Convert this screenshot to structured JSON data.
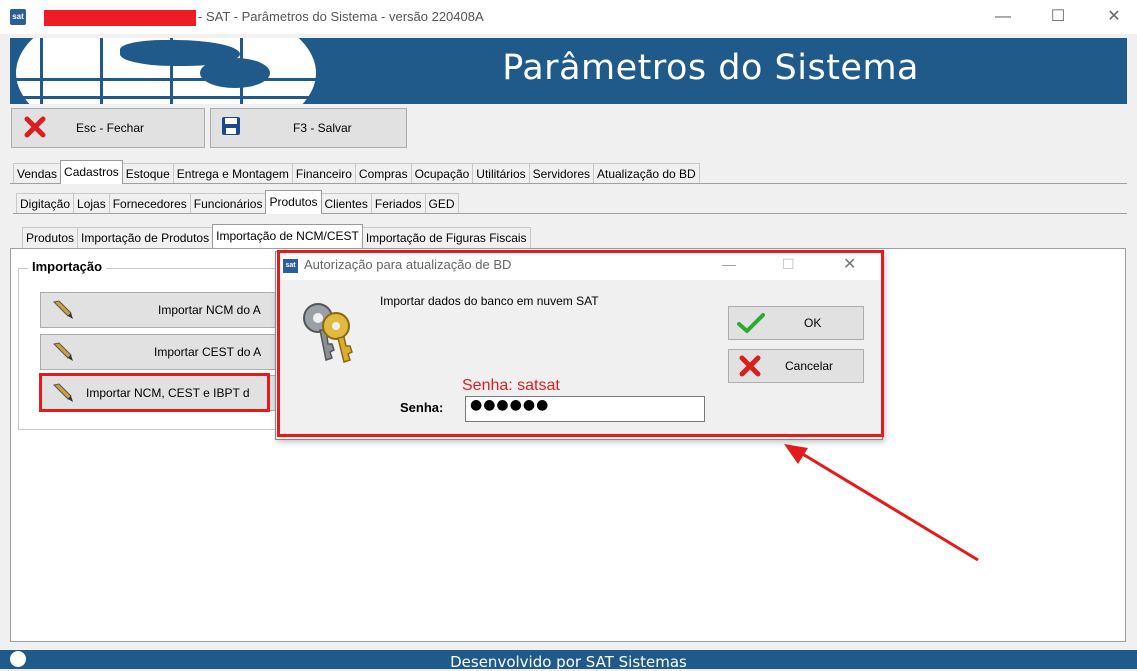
{
  "window": {
    "title": "- SAT - Parâmetros do Sistema - versão 220408A",
    "app_icon": "sat-logo-icon"
  },
  "banner": {
    "title": "Parâmetros do Sistema"
  },
  "toolbar": {
    "close_label": "Esc - Fechar",
    "save_label": "F3 - Salvar"
  },
  "tabs_main": [
    "Vendas",
    "Cadastros",
    "Estoque",
    "Entrega e Montagem",
    "Financeiro",
    "Compras",
    "Ocupação",
    "Utilitários",
    "Servidores",
    "Atualização do BD"
  ],
  "tabs_cadastros": [
    "Digitação",
    "Lojas",
    "Fornecedores",
    "Funcionários",
    "Produtos",
    "Clientes",
    "Feriados",
    "GED"
  ],
  "tabs_produtos": [
    "Produtos",
    "Importação de Produtos",
    "Importação de NCM/CEST",
    "Importação de Figuras Fiscais"
  ],
  "active": {
    "main": "Cadastros",
    "cadastros": "Produtos",
    "produtos": "Importação de NCM/CEST"
  },
  "group": {
    "title": "Importação",
    "buttons": [
      "Importar NCM do A",
      "Importar CEST do A",
      "Importar NCM, CEST e IBPT d"
    ]
  },
  "dialog": {
    "title": "Autorização para atualização de BD",
    "message": "Importar dados do banco em nuvem SAT",
    "password_hint": "Senha: satsat",
    "password_label": "Senha:",
    "password_value": "●●●●●●",
    "ok_label": "OK",
    "cancel_label": "Cancelar"
  },
  "footer": {
    "text": "Desenvolvido por SAT Sistemas"
  },
  "colors": {
    "banner": "#1f5a8b",
    "highlight": "#e51b1b"
  }
}
